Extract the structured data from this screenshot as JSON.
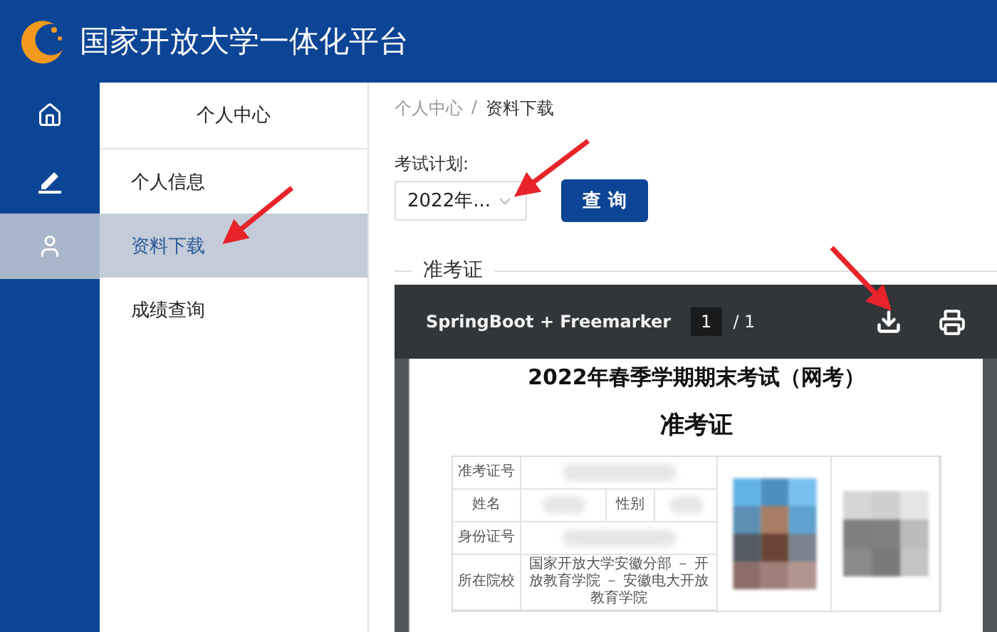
{
  "header": {
    "title": "国家开放大学一体化平台"
  },
  "rail": [
    {
      "kind": "home",
      "selected": false
    },
    {
      "kind": "edit",
      "selected": false
    },
    {
      "kind": "user",
      "selected": true
    }
  ],
  "submenu": {
    "title": "个人中心",
    "items": [
      {
        "label": "个人信息",
        "selected": false
      },
      {
        "label": "资料下载",
        "selected": true
      },
      {
        "label": "成绩查询",
        "selected": false
      }
    ]
  },
  "breadcrumb": [
    "个人中心",
    "/",
    "资料下载"
  ],
  "filter": {
    "label": "考试计划:",
    "select_value": "2022年...",
    "button": "查 询"
  },
  "section": {
    "legend": "准考证"
  },
  "viewer": {
    "title": "SpringBoot + Freemarker",
    "page": "1",
    "total": "/ 1"
  },
  "document": {
    "heading": "2022年春季学期期末考试（网考）",
    "title": "准考证",
    "rows": [
      {
        "label": "准考证号"
      },
      {
        "label": "姓名",
        "extra_label": "性别"
      },
      {
        "label": "身份证号"
      },
      {
        "label": "所在院校",
        "value": "国家开放大学安徽分部 － 开放教育学院 － 安徽电大开放教育学院"
      }
    ]
  }
}
